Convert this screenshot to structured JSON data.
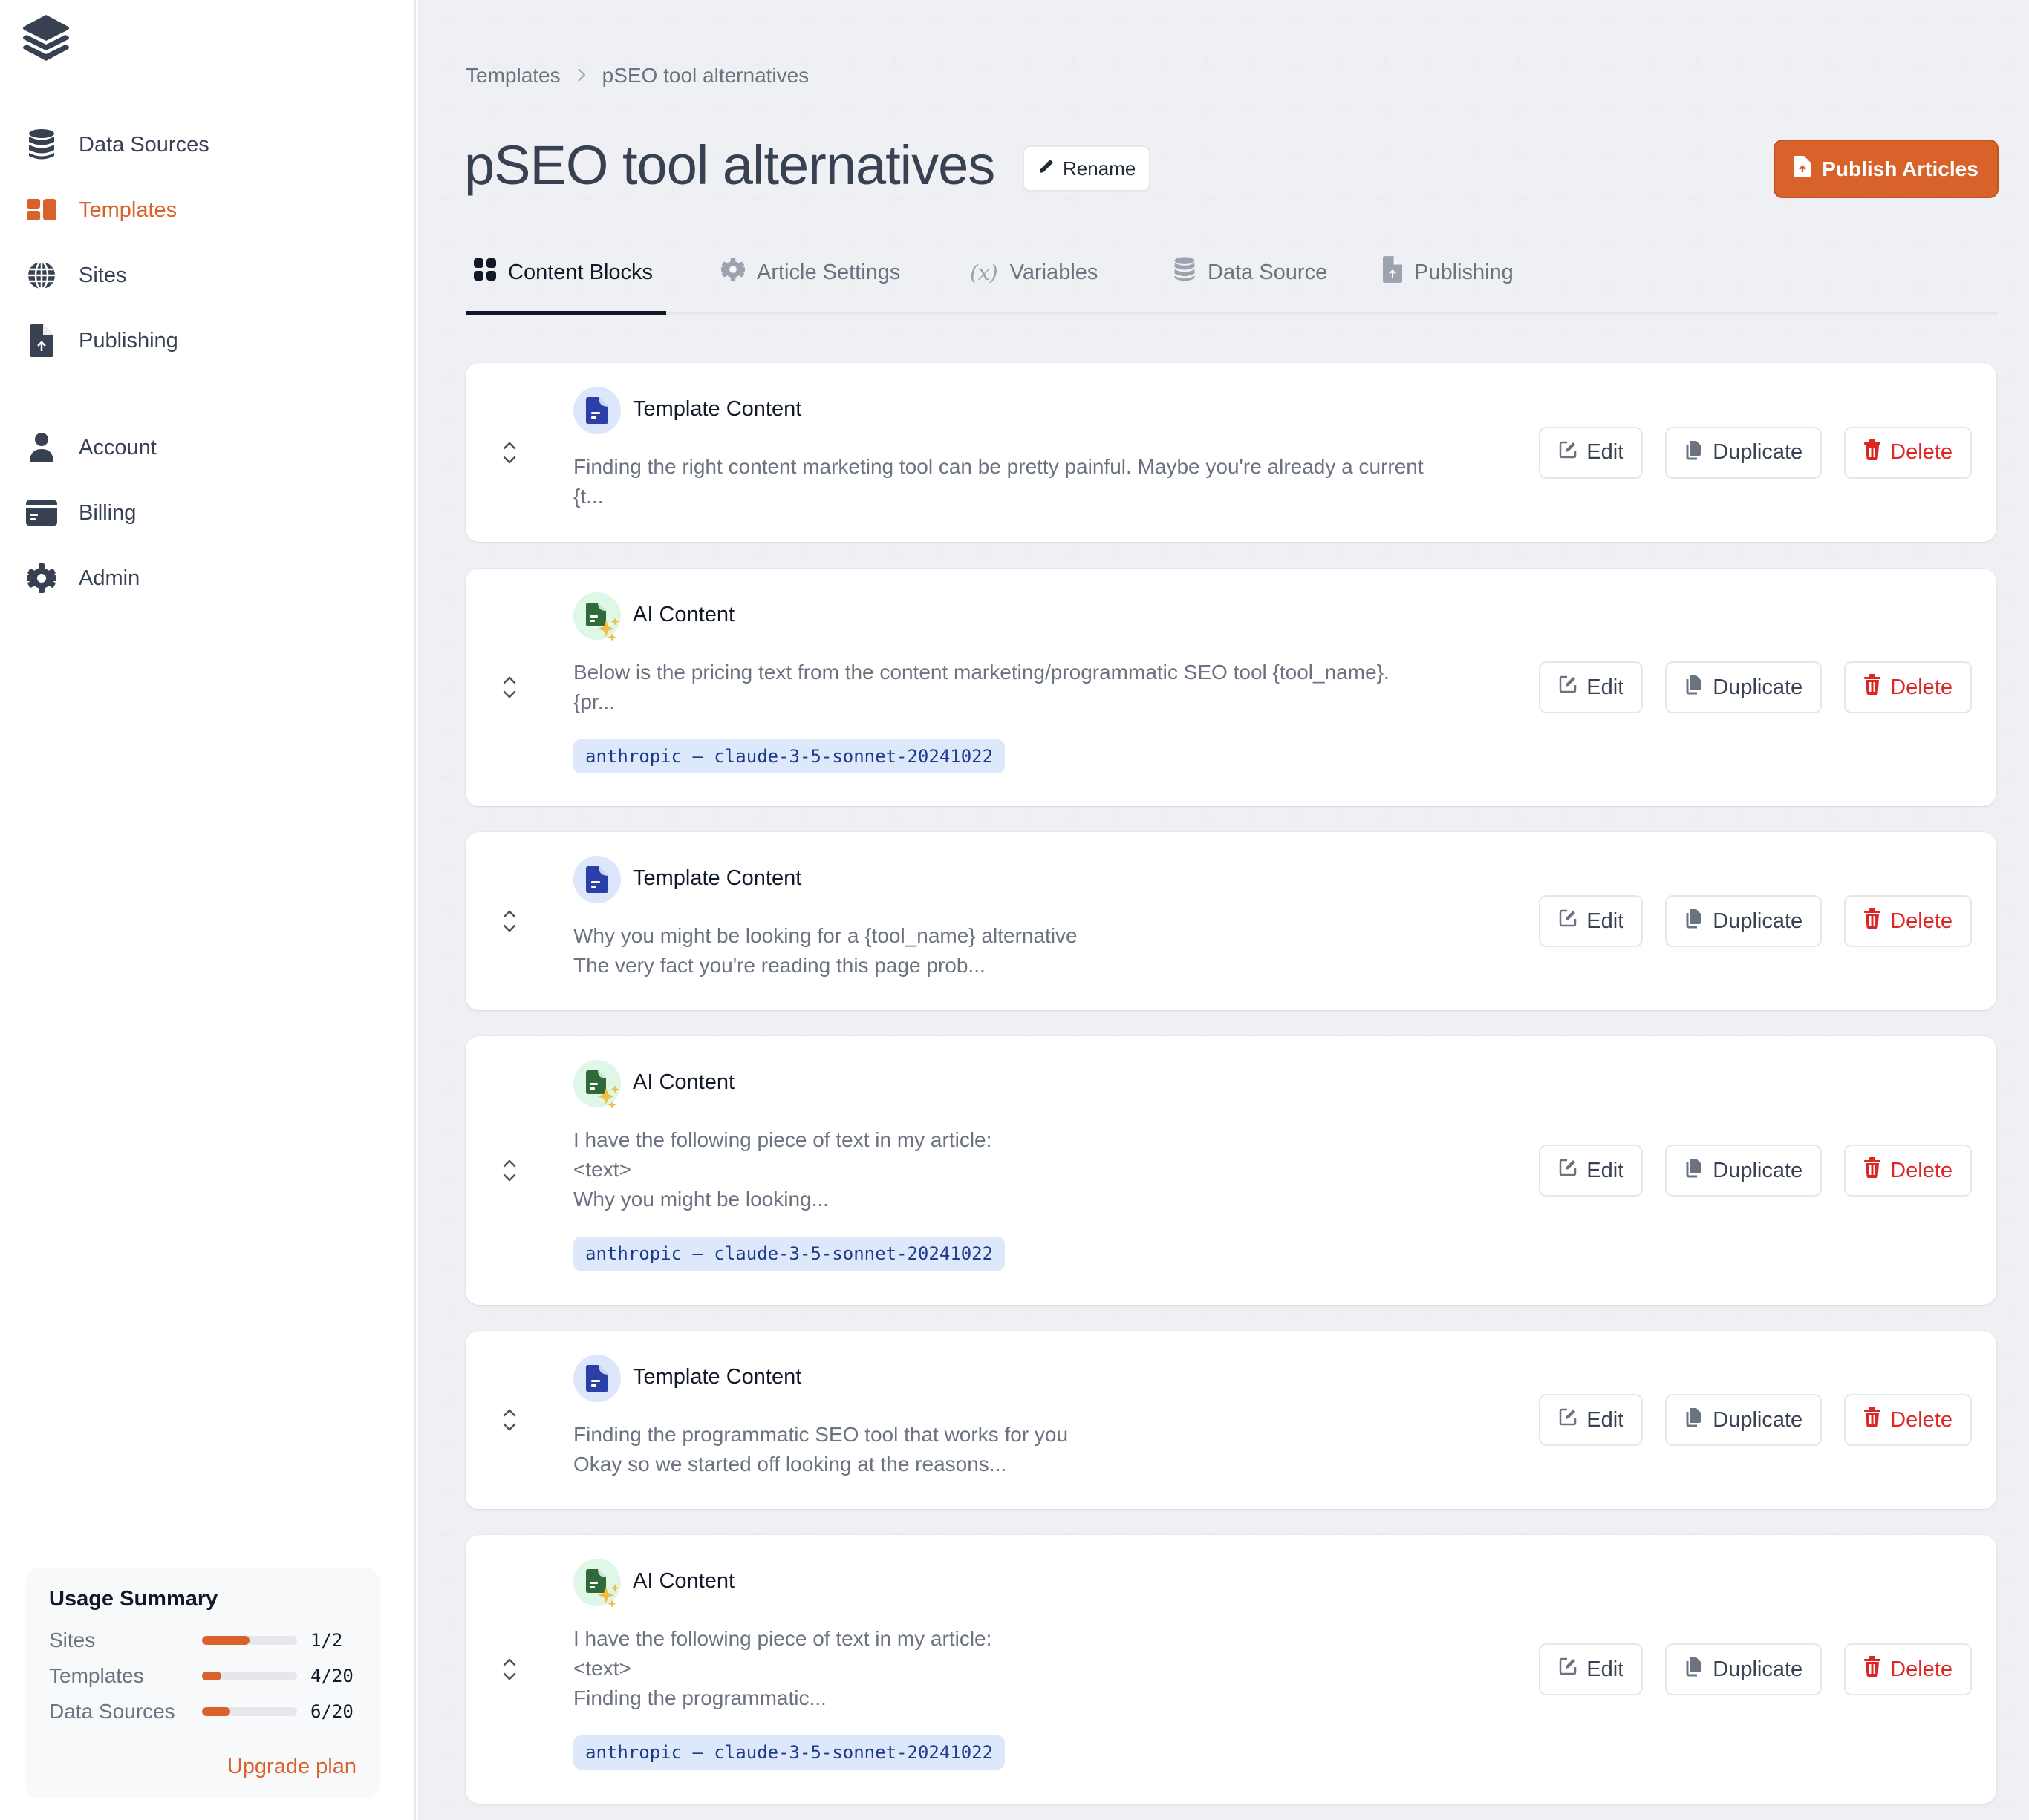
{
  "sidebar": {
    "logo": "stack-layers-logo",
    "nav_primary": [
      {
        "label": "Data Sources",
        "icon": "database-icon",
        "active": false
      },
      {
        "label": "Templates",
        "icon": "templates-icon",
        "active": true
      },
      {
        "label": "Sites",
        "icon": "globe-icon",
        "active": false
      },
      {
        "label": "Publishing",
        "icon": "file-upload-icon",
        "active": false
      }
    ],
    "nav_secondary": [
      {
        "label": "Account",
        "icon": "user-icon"
      },
      {
        "label": "Billing",
        "icon": "credit-card-icon"
      },
      {
        "label": "Admin",
        "icon": "gear-icon"
      }
    ],
    "usage": {
      "title": "Usage Summary",
      "rows": [
        {
          "label": "Sites",
          "value": "1/2",
          "used": 1,
          "limit": 2
        },
        {
          "label": "Templates",
          "value": "4/20",
          "used": 4,
          "limit": 20
        },
        {
          "label": "Data Sources",
          "value": "6/20",
          "used": 6,
          "limit": 20
        }
      ],
      "upgrade_label": "Upgrade plan"
    }
  },
  "header": {
    "breadcrumb": [
      "Templates",
      "pSEO tool alternatives"
    ],
    "breadcrumb_separator": ">",
    "title": "pSEO tool alternatives",
    "rename_label": "Rename",
    "publish_label": "Publish Articles"
  },
  "tabs": [
    {
      "label": "Content Blocks",
      "icon": "grid-icon",
      "active": true
    },
    {
      "label": "Article Settings",
      "icon": "gear-icon",
      "active": false
    },
    {
      "label": "Variables",
      "icon": "variable-icon",
      "active": false
    },
    {
      "label": "Data Source",
      "icon": "database-icon",
      "active": false
    },
    {
      "label": "Publishing",
      "icon": "file-upload-icon",
      "active": false
    }
  ],
  "blocks": [
    {
      "type": "template",
      "title": "Template Content",
      "body": "Finding the right content marketing tool can be pretty painful. Maybe you're already a current\n{t...",
      "model": null
    },
    {
      "type": "ai",
      "title": "AI Content",
      "body": "Below is the pricing text from the content marketing/programmatic SEO tool {tool_name}.\n{pr...",
      "model": "anthropic – claude-3-5-sonnet-20241022"
    },
    {
      "type": "template",
      "title": "Template Content",
      "body": "Why you might be looking for a {tool_name} alternative\nThe very fact you're reading this page prob...",
      "model": null
    },
    {
      "type": "ai",
      "title": "AI Content",
      "body": "I have the following piece of text in my article:\n<text>\nWhy you might be looking...",
      "model": "anthropic – claude-3-5-sonnet-20241022"
    },
    {
      "type": "template",
      "title": "Template Content",
      "body": "Finding the programmatic SEO tool that works for you\nOkay so we started off looking at the reasons...",
      "model": null
    },
    {
      "type": "ai",
      "title": "AI Content",
      "body": "I have the following piece of text in my article:\n<text>\nFinding the programmatic...",
      "model": "anthropic – claude-3-5-sonnet-20241022"
    }
  ],
  "actions": {
    "edit_label": "Edit",
    "duplicate_label": "Duplicate",
    "delete_label": "Delete"
  },
  "colors": {
    "accent": "#D9622B",
    "danger": "#DC2626",
    "template_icon": "#2A3FA8",
    "ai_icon": "#2F6B3A",
    "sparkle": "#F2BD42",
    "badge_bg": "#DDE8FB",
    "badge_text": "#1E3A8A"
  }
}
